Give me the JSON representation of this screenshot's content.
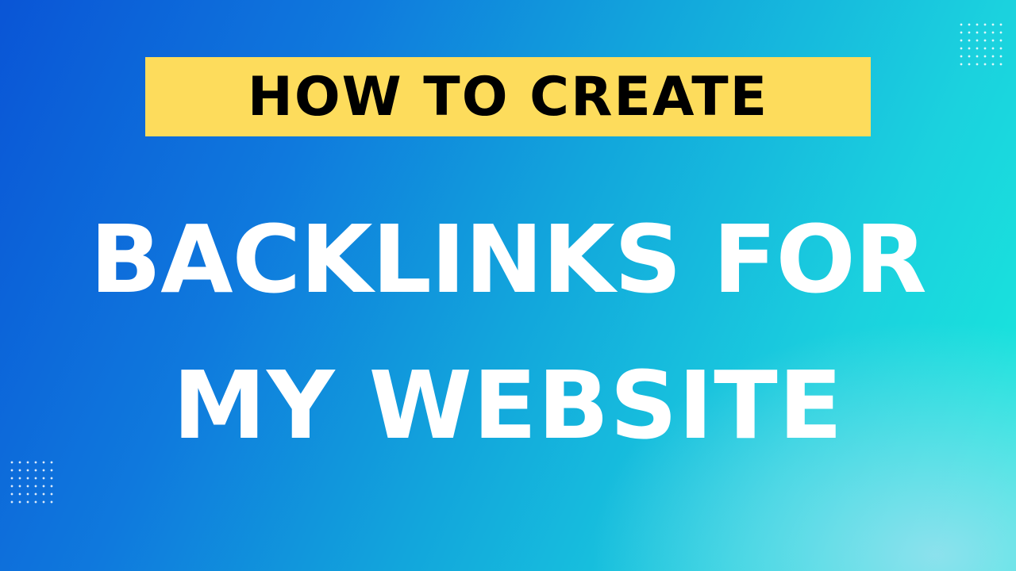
{
  "banner": {
    "text": "HOW TO CREATE",
    "color": "#fddc5c"
  },
  "headline": {
    "line1": "BACKLINKS FOR",
    "line2": "MY WEBSITE"
  },
  "colors": {
    "gradient_start": "#0a55d6",
    "gradient_end": "#17ebdc",
    "text": "#ffffff"
  }
}
